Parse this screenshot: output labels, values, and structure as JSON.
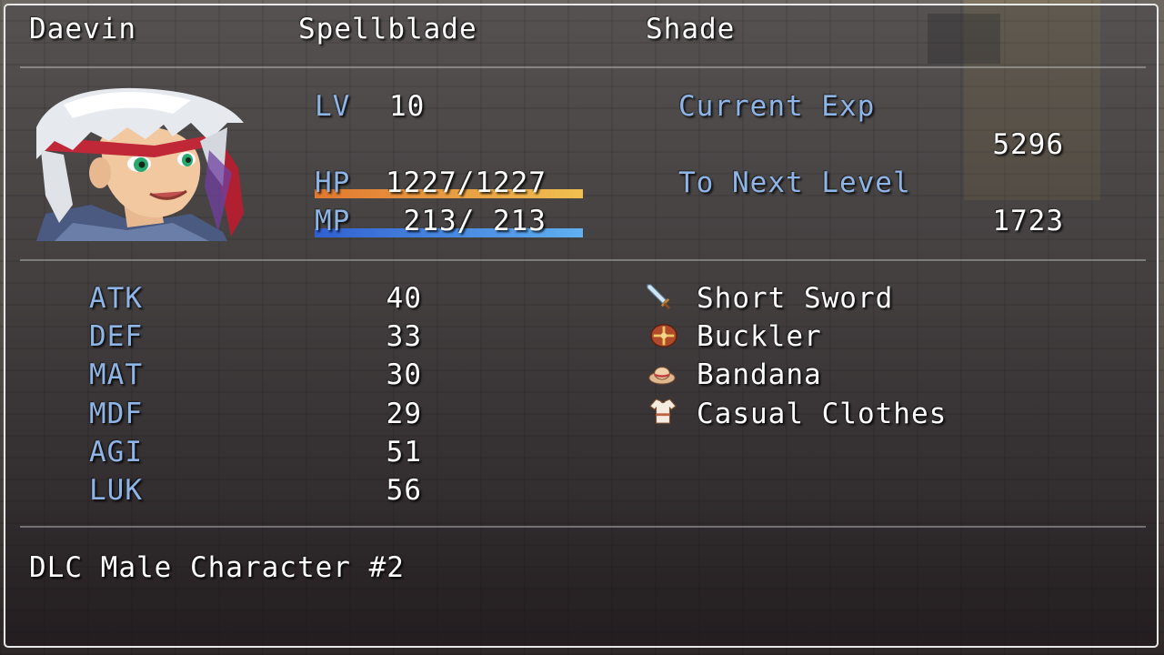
{
  "header": {
    "name": "Daevin",
    "class": "Spellblade",
    "nickname": "Shade"
  },
  "level": {
    "label": "LV",
    "value": "10"
  },
  "hp": {
    "label": "HP",
    "value": "1227/1227",
    "fraction": 1.0,
    "color_start": "#e07830",
    "color_end": "#f0c050"
  },
  "mp": {
    "label": "MP",
    "value": " 213/ 213",
    "fraction": 1.0,
    "color_start": "#3060d0",
    "color_end": "#60b0f0"
  },
  "exp": {
    "current_label": "Current Exp",
    "current_value": "5296",
    "next_label": "To Next Level",
    "next_value": "1723"
  },
  "params": [
    {
      "label": "ATK",
      "value": "40"
    },
    {
      "label": "DEF",
      "value": "33"
    },
    {
      "label": "MAT",
      "value": "30"
    },
    {
      "label": "MDF",
      "value": "29"
    },
    {
      "label": "AGI",
      "value": "51"
    },
    {
      "label": "LUK",
      "value": "56"
    }
  ],
  "equipment": [
    {
      "name": "Short Sword",
      "icon": "sword-icon"
    },
    {
      "name": "Buckler",
      "icon": "shield-icon"
    },
    {
      "name": "Bandana",
      "icon": "hat-icon"
    },
    {
      "name": "Casual Clothes",
      "icon": "clothes-icon"
    }
  ],
  "profile": "DLC Male Character #2",
  "colors": {
    "system_blue": "#8fb4e6",
    "text": "#ffffff"
  }
}
